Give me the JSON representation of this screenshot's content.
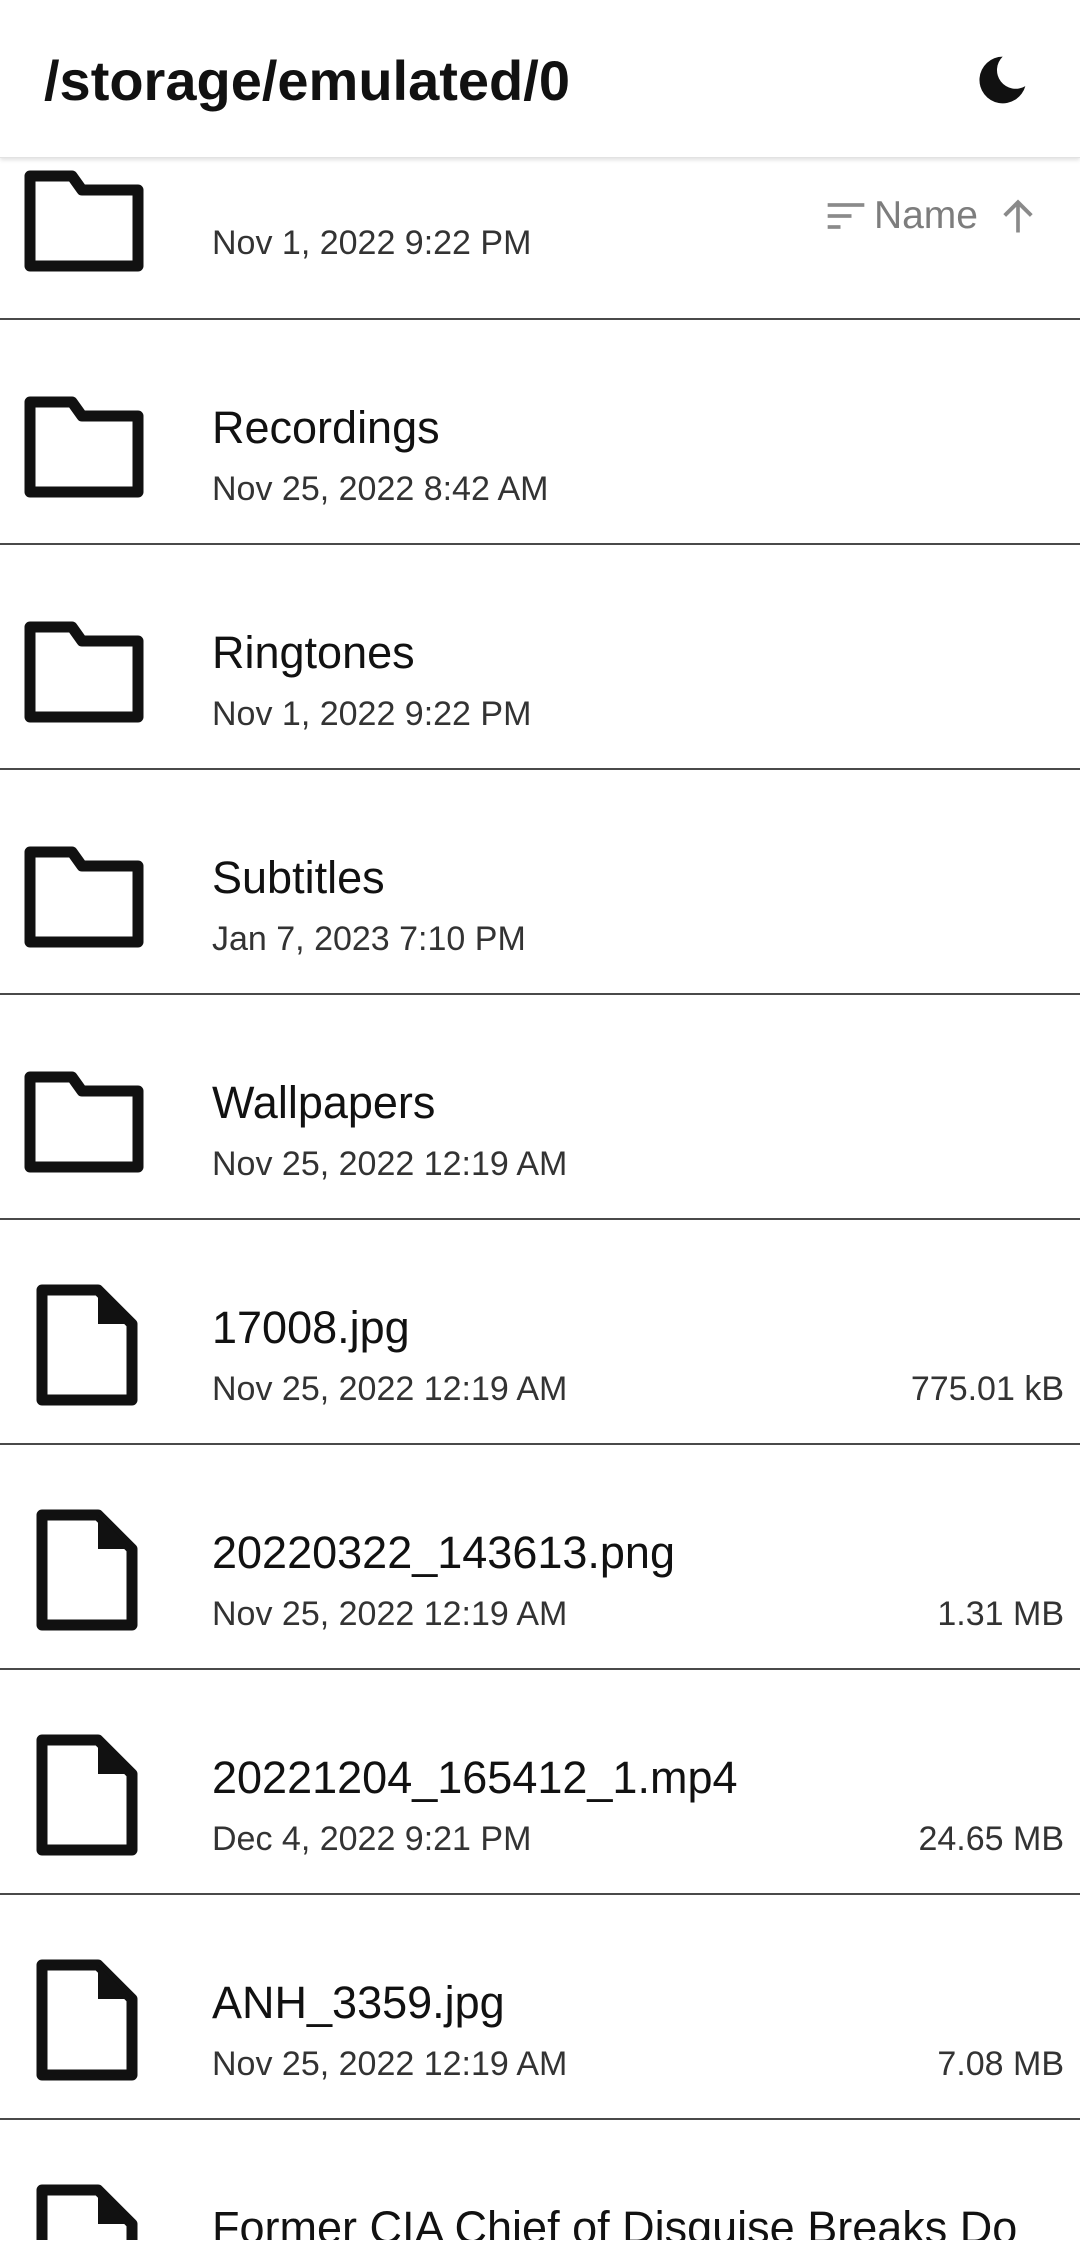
{
  "app_bar": {
    "path": "/storage/emulated/0",
    "theme_icon": "moon-icon"
  },
  "sort": {
    "icon": "sort-icon",
    "label": "Name",
    "direction_icon": "arrow-up-icon"
  },
  "items": [
    {
      "type": "folder",
      "name": "",
      "date": "Nov 1, 2022 9:22 PM",
      "size": ""
    },
    {
      "type": "folder",
      "name": "Recordings",
      "date": "Nov 25, 2022 8:42 AM",
      "size": ""
    },
    {
      "type": "folder",
      "name": "Ringtones",
      "date": "Nov 1, 2022 9:22 PM",
      "size": ""
    },
    {
      "type": "folder",
      "name": "Subtitles",
      "date": "Jan 7, 2023 7:10 PM",
      "size": ""
    },
    {
      "type": "folder",
      "name": "Wallpapers",
      "date": "Nov 25, 2022 12:19 AM",
      "size": ""
    },
    {
      "type": "file",
      "name": "17008.jpg",
      "date": "Nov 25, 2022 12:19 AM",
      "size": "775.01 kB"
    },
    {
      "type": "file",
      "name": "20220322_143613.png",
      "date": "Nov 25, 2022 12:19 AM",
      "size": "1.31 MB"
    },
    {
      "type": "file",
      "name": "20221204_165412_1.mp4",
      "date": "Dec 4, 2022 9:21 PM",
      "size": "24.65 MB"
    },
    {
      "type": "file",
      "name": "ANH_3359.jpg",
      "date": "Nov 25, 2022 12:19 AM",
      "size": "7.08 MB"
    },
    {
      "type": "file",
      "name": "Former CIA Chief of Disguise Breaks Do",
      "date": "",
      "size": ""
    }
  ]
}
